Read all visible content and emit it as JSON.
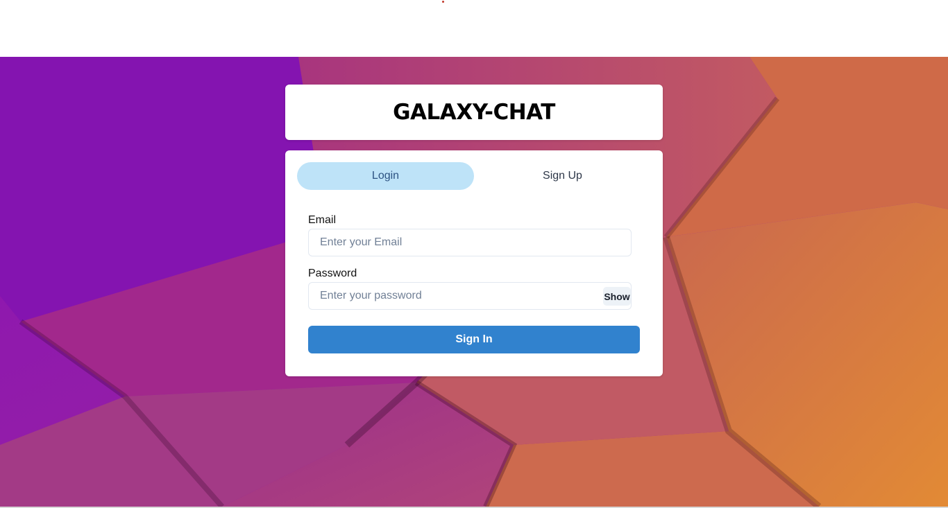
{
  "app": {
    "title": "GALAXY-CHAT"
  },
  "tabs": [
    {
      "label": "Login",
      "selected": true
    },
    {
      "label": "Sign Up",
      "selected": false
    }
  ],
  "form": {
    "email_label": "Email",
    "email_placeholder": "Enter your Email",
    "email_value": "",
    "password_label": "Password",
    "password_placeholder": "Enter your password",
    "password_value": "",
    "show_label": "Show",
    "submit_label": "Sign In"
  },
  "colors": {
    "tab_selected_bg": "#bee3f8",
    "primary": "#3182ce",
    "background_gradient": [
      "#7a0fa8",
      "#c0506a",
      "#e59030"
    ]
  }
}
